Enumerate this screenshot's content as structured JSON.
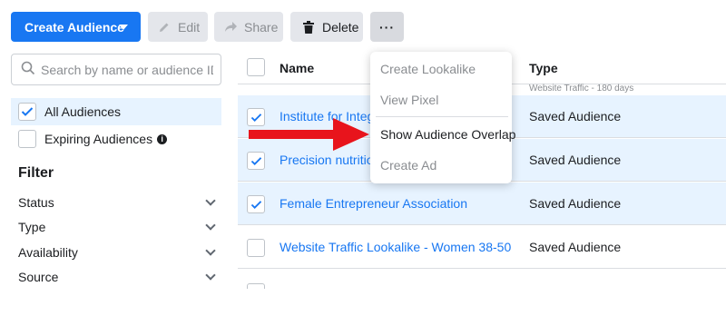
{
  "toolbar": {
    "create_label": "Create Audience",
    "edit_label": "Edit",
    "share_label": "Share",
    "delete_label": "Delete",
    "more_label": "···"
  },
  "sidebar": {
    "search_placeholder": "Search by name or audience ID",
    "audiences": [
      {
        "label": "All Audiences",
        "checked": true
      },
      {
        "label": "Expiring Audiences",
        "checked": false
      }
    ],
    "filter_title": "Filter",
    "filters": [
      "Status",
      "Type",
      "Availability",
      "Source"
    ]
  },
  "table": {
    "headers": {
      "name": "Name",
      "type": "Type"
    },
    "type_subtitle": "Website Traffic - 180 days",
    "rows": [
      {
        "name": "Institute for Integr",
        "type": "Saved Audience",
        "checked": true
      },
      {
        "name": "Precision nutrition",
        "type": "Saved Audience",
        "checked": true
      },
      {
        "name": "Female Entrepreneur Association",
        "type": "Saved Audience",
        "checked": true
      },
      {
        "name": "Website Traffic Lookalike - Women 38-50",
        "type": "Saved Audience",
        "checked": false
      }
    ]
  },
  "menu": {
    "items": [
      {
        "label": "Create Lookalike",
        "enabled": false
      },
      {
        "label": "View Pixel",
        "enabled": false
      },
      {
        "label": "Show Audience Overlap",
        "enabled": true
      },
      {
        "label": "Create Ad",
        "enabled": false
      }
    ]
  },
  "colors": {
    "accent": "#1877f2",
    "selected_row": "#e7f3ff",
    "annotation_arrow": "#e8141c"
  },
  "icons": {
    "create_caret": "caret-down-icon",
    "edit": "pencil-icon",
    "share": "share-arrow-icon",
    "delete": "trash-icon",
    "more": "ellipsis-icon",
    "search": "search-icon",
    "check": "checkmark-icon",
    "info": "info-icon",
    "filter_chevron": "chevron-down-icon",
    "annotation": "red-arrow-icon"
  }
}
